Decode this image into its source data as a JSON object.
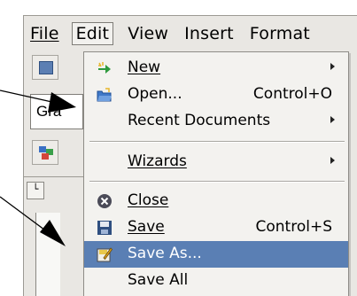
{
  "menubar": {
    "items": [
      "File",
      "Edit",
      "View",
      "Insert",
      "Format"
    ]
  },
  "toolbar": {
    "font_value": "Gra"
  },
  "ruler": {
    "corner_glyph": "└"
  },
  "file_menu": {
    "entries": [
      {
        "label": "New",
        "shortcut": "",
        "submenu": true,
        "icon": "new-document-icon"
      },
      {
        "label": "Open...",
        "shortcut": "Control+O",
        "submenu": false,
        "icon": "open-folder-icon"
      },
      {
        "label": "Recent Documents",
        "shortcut": "",
        "submenu": true,
        "icon": ""
      },
      {
        "label": "Wizards",
        "shortcut": "",
        "submenu": true,
        "icon": ""
      },
      {
        "label": "Close",
        "shortcut": "",
        "submenu": false,
        "icon": "close-circle-icon"
      },
      {
        "label": "Save",
        "shortcut": "Control+S",
        "submenu": false,
        "icon": "floppy-disk-icon"
      },
      {
        "label": "Save As...",
        "shortcut": "",
        "submenu": false,
        "icon": "save-as-icon",
        "highlighted": true
      },
      {
        "label": "Save All",
        "shortcut": "",
        "submenu": false,
        "icon": ""
      }
    ]
  },
  "colors": {
    "highlight": "#5a7fb4",
    "menu_background": "#f3f2ef",
    "window_background": "#e9e7e3"
  }
}
